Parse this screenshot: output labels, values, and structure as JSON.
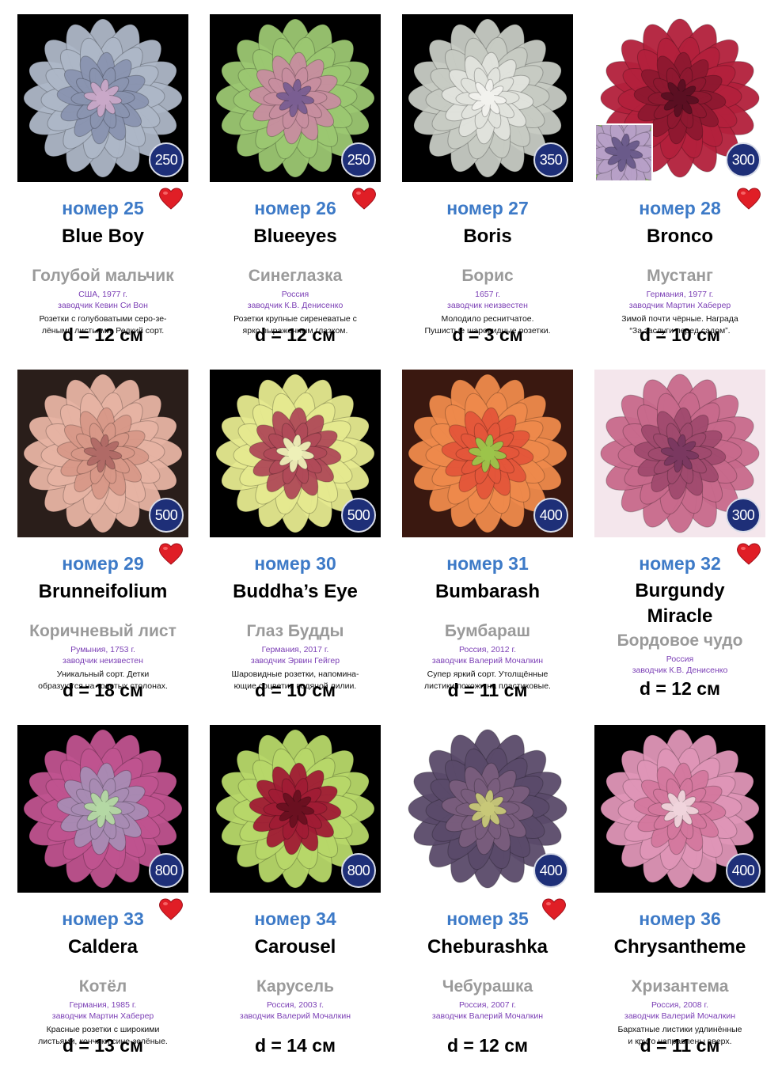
{
  "items": [
    {
      "number": "номер 25",
      "name": "Blue Boy",
      "name_ru": "Голубой мальчик",
      "origin": "США, 1977 г.",
      "breeder": "заводчик Кевин Си Вон",
      "desc1": "Розетки с голубоватыми серо-зе-",
      "desc2": "лёными листьями. Редкий сорт.",
      "diameter": "d = 12 см",
      "price": "250",
      "favorite": true,
      "colors": {
        "bg": "#000000",
        "outer": "#aeb8c8",
        "inner": "#8a94b0",
        "core": "#c9a8c8"
      }
    },
    {
      "number": "номер 26",
      "name": "Blueeyes",
      "name_ru": "Синеглазка",
      "origin": "Россия",
      "breeder": "заводчик К.В. Денисенко",
      "desc1": "Розетки крупные сиреневатые с",
      "desc2": "ярко выраженным глазком.",
      "diameter": "d = 12 см",
      "price": "250",
      "favorite": true,
      "colors": {
        "bg": "#000000",
        "outer": "#9cc872",
        "inner": "#c88ea0",
        "core": "#7a5e92"
      }
    },
    {
      "number": "номер 27",
      "name": "Boris",
      "name_ru": "Борис",
      "origin": "1657 г.",
      "breeder": "заводчик неизвестен",
      "desc1": "Молодило реснитчатое.",
      "desc2": "Пушистые шаровидные розетки.",
      "diameter": "d = 3 см",
      "price": "350",
      "favorite": false,
      "colors": {
        "bg": "#000000",
        "outer": "#c8ccc4",
        "inner": "#e2e4de",
        "core": "#f2f2ee"
      }
    },
    {
      "number": "номер 28",
      "name": "Bronco",
      "name_ru": "Мустанг",
      "origin": "Германия, 1977 г.",
      "breeder": "заводчик Мартин Хаберер",
      "desc1": "Зимой почти чёрные. Награда",
      "desc2": "“За заслуги перед садом”.",
      "diameter": "d = 10 см",
      "price": "300",
      "favorite": true,
      "colors": {
        "bg": "#ffffff",
        "outer": "#b3203c",
        "inner": "#8e1830",
        "core": "#5a0f22"
      }
    },
    {
      "number": "номер 29",
      "name": "Brunneifolium",
      "name_ru": "Коричневый лист",
      "origin": "Румыния, 1753 г.",
      "breeder": "заводчик неизвестен",
      "desc1": "Уникальный сорт. Детки",
      "desc2": "образуются на толстых столонах.",
      "diameter": "d = 18 см",
      "price": "500",
      "favorite": true,
      "colors": {
        "bg": "#2a1e1a",
        "outer": "#e7b4a4",
        "inner": "#d89888",
        "core": "#b06a66"
      }
    },
    {
      "number": "номер 30",
      "name": "Buddha’s Eye",
      "name_ru": "Глаз Будды",
      "origin": "Германия, 2017 г.",
      "breeder": "заводчик Эрвин Гейгер",
      "desc1": "Шаровидные розетки, напомина-",
      "desc2": "ющие соцветия водяной лилии.",
      "diameter": "d = 10 см",
      "price": "500",
      "favorite": false,
      "colors": {
        "bg": "#000000",
        "outer": "#e6ea90",
        "inner": "#b04a58",
        "core": "#eef0b8"
      }
    },
    {
      "number": "номер 31",
      "name": "Bumbarash",
      "name_ru": "Бумбараш",
      "origin": "Россия, 2012 г.",
      "breeder": "заводчик Валерий Мочалкин",
      "desc1": "Супер яркий сорт. Утолщённые",
      "desc2": "листики похожи на пластиковые.",
      "diameter": "d = 11 см",
      "price": "400",
      "favorite": false,
      "colors": {
        "bg": "#3a1810",
        "outer": "#ef8a4c",
        "inner": "#e4563a",
        "core": "#9cc44a"
      }
    },
    {
      "number": "номер 32",
      "name": "Burgundy",
      "name2": "Miracle",
      "name_ru": "Бордовое чудо",
      "origin": "Россия",
      "breeder": "заводчик К.В. Денисенко",
      "desc1": "",
      "desc2": "",
      "diameter": "d = 12 см",
      "price": "300",
      "favorite": true,
      "colors": {
        "bg": "#f4e6ec",
        "outer": "#c86a8c",
        "inner": "#a04a6e",
        "core": "#7a3860"
      }
    },
    {
      "number": "номер 33",
      "name": "Caldera",
      "name_ru": "Котёл",
      "origin": "Германия, 1985 г.",
      "breeder": "заводчик Мартин Хаберер",
      "desc1": "Красные розетки с широкими",
      "desc2": "листьями, кончики сине-зелёные.",
      "diameter": "d = 13 см",
      "price": "800",
      "favorite": true,
      "colors": {
        "bg": "#000000",
        "outer": "#c05490",
        "inner": "#a88cb4",
        "core": "#b4d8a4"
      }
    },
    {
      "number": "номер 34",
      "name": "Carousel",
      "name_ru": "Карусель",
      "origin": "Россия, 2003 г.",
      "breeder": "заводчик Валерий Мочалкин",
      "desc1": "",
      "desc2": "",
      "diameter": "d = 14 см",
      "price": "800",
      "favorite": false,
      "colors": {
        "bg": "#000000",
        "outer": "#b8d86a",
        "inner": "#a01c34",
        "core": "#6a1020"
      }
    },
    {
      "number": "номер 35",
      "name": "Cheburashka",
      "name_ru": "Чебурашка",
      "origin": "Россия, 2007 г.",
      "breeder": "заводчик Валерий Мочалкин",
      "desc1": "",
      "desc2": "",
      "diameter": "d = 12 см",
      "price": "400",
      "favorite": true,
      "colors": {
        "bg": "#ffffff",
        "outer": "#5a4a6a",
        "inner": "#7a5e7e",
        "core": "#c8c878"
      }
    },
    {
      "number": "номер 36",
      "name": "Chrysantheme",
      "name_ru": "Хризантема",
      "origin": "Россия, 2008 г.",
      "breeder": "заводчик Валерий Мочалкин",
      "desc1": "Бархатные листики удлинённые",
      "desc2": "и круто направлены вверх.",
      "diameter": "d = 11 см",
      "price": "400",
      "favorite": false,
      "colors": {
        "bg": "#000000",
        "outer": "#e096b8",
        "inner": "#d4789e",
        "core": "#f0d4dc"
      }
    }
  ]
}
